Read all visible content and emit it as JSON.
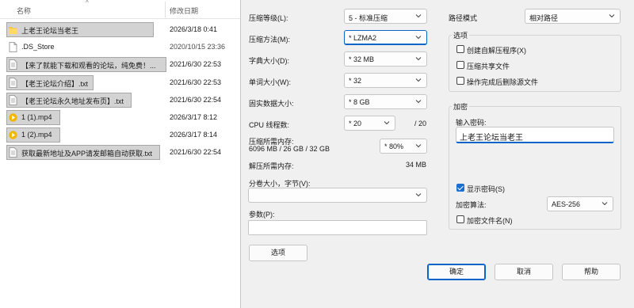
{
  "explorer": {
    "col_name": "名称",
    "col_date": "修改日期",
    "files": [
      {
        "name": "上老王论坛当老王",
        "date": "2026/3/18 0:41",
        "icon": "folder-icon",
        "selected": true
      },
      {
        "name": ".DS_Store",
        "date": "2020/10/15 23:36",
        "icon": "file-icon",
        "selected": false
      },
      {
        "name": "【来了就能下载和观看的论坛，纯免费！...",
        "date": "2021/6/30 22:53",
        "icon": "text-file-icon",
        "selected": true
      },
      {
        "name": "【老王论坛介绍】.txt",
        "date": "2021/6/30 22:53",
        "icon": "text-file-icon",
        "selected": true
      },
      {
        "name": "【老王论坛永久地址发布页】.txt",
        "date": "2021/6/30 22:54",
        "icon": "text-file-icon",
        "selected": true
      },
      {
        "name": "1 (1).mp4",
        "date": "2026/3/17 8:12",
        "icon": "video-file-icon",
        "selected": true
      },
      {
        "name": "1 (2).mp4",
        "date": "2026/3/17 8:14",
        "icon": "video-file-icon",
        "selected": true
      },
      {
        "name": "获取最新地址及APP请发邮箱自动获取.txt",
        "date": "2021/6/30 22:54",
        "icon": "text-file-icon",
        "selected": true
      }
    ]
  },
  "dialog": {
    "compression_level_label": "压缩等级(L):",
    "compression_level_value": "5 - 标准压缩",
    "compression_method_label": "压缩方法(M):",
    "compression_method_value": "* LZMA2",
    "dictionary_size_label": "字典大小(D):",
    "dictionary_size_value": "* 32 MB",
    "word_size_label": "单词大小(W):",
    "word_size_value": "* 32",
    "solid_block_label": "固实数据大小:",
    "solid_block_value": "* 8 GB",
    "cpu_threads_label": "CPU 线程数:",
    "cpu_threads_value": "* 20",
    "cpu_threads_total": "/ 20",
    "memory_compress_label": "压缩所需内存:",
    "memory_compress_detail": "6096 MB / 26 GB / 32 GB",
    "memory_percent_value": "* 80%",
    "memory_decompress_label": "解压所需内存:",
    "memory_decompress_value": "34 MB",
    "split_volume_label": "分卷大小，字节(V):",
    "split_volume_value": "",
    "parameters_label": "参数(P):",
    "parameters_value": "",
    "options_button": "选项",
    "path_mode_label": "路径模式",
    "path_mode_value": "相对路径",
    "options_group_title": "选项",
    "options": [
      {
        "label": "创建自解压程序(X)",
        "checked": false
      },
      {
        "label": "压缩共享文件",
        "checked": false
      },
      {
        "label": "操作完成后删除源文件",
        "checked": false
      }
    ],
    "encryption_group_title": "加密",
    "password_label": "输入密码:",
    "password_value": "上老王论坛当老王",
    "show_password_label": "显示密码(S)",
    "show_password_checked": true,
    "encryption_method_label": "加密算法:",
    "encryption_method_value": "AES-256",
    "encrypt_filenames_label": "加密文件名(N)",
    "encrypt_filenames_checked": false,
    "ok_button": "确定",
    "cancel_button": "取消",
    "help_button": "帮助"
  },
  "colors": {
    "accent": "#0a64c8",
    "selection": "#d3d3d3",
    "folder": "#f4c542",
    "video": "#f2b705"
  }
}
